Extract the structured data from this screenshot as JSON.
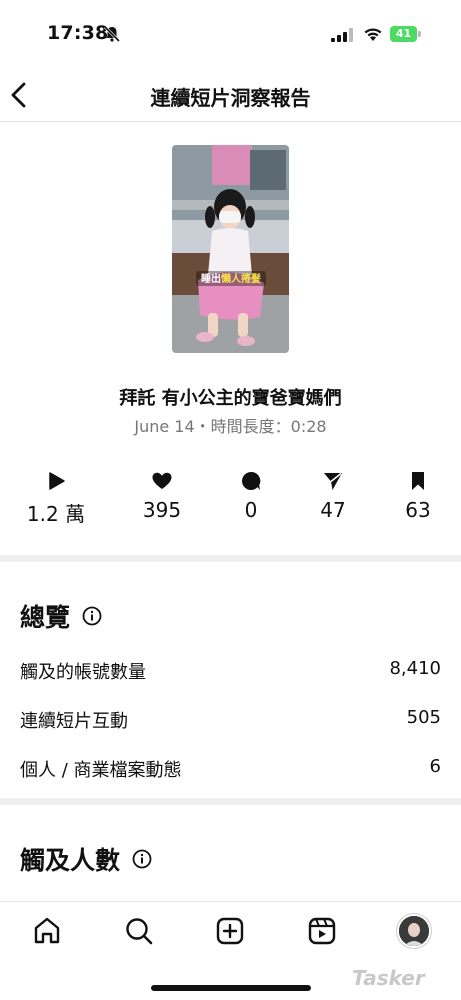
{
  "status_bar": {
    "time": "17:38",
    "battery": "41"
  },
  "header": {
    "title": "連續短片洞察報告"
  },
  "video": {
    "overlay_text_white": "睡出",
    "overlay_text_yellow": "懶人捲髮",
    "title": "拜託 有小公主的寶爸寶媽們",
    "meta": "June 14・時間長度：0:28"
  },
  "stats": [
    {
      "icon": "play-icon",
      "value": "1.2 萬"
    },
    {
      "icon": "heart-icon",
      "value": "395"
    },
    {
      "icon": "comment-icon",
      "value": "0"
    },
    {
      "icon": "share-icon",
      "value": "47"
    },
    {
      "icon": "bookmark-icon",
      "value": "63"
    }
  ],
  "overview": {
    "title": "總覽",
    "rows": [
      {
        "label": "觸及的帳號數量",
        "value": "8,410"
      },
      {
        "label": "連續短片互動",
        "value": "505"
      },
      {
        "label": "個人 / 商業檔案動態",
        "value": "6"
      }
    ]
  },
  "reach": {
    "title": "觸及人數"
  },
  "tabbar": [
    "home-icon",
    "search-icon",
    "create-icon",
    "reels-icon",
    "profile-avatar"
  ],
  "watermark": "Tasker"
}
